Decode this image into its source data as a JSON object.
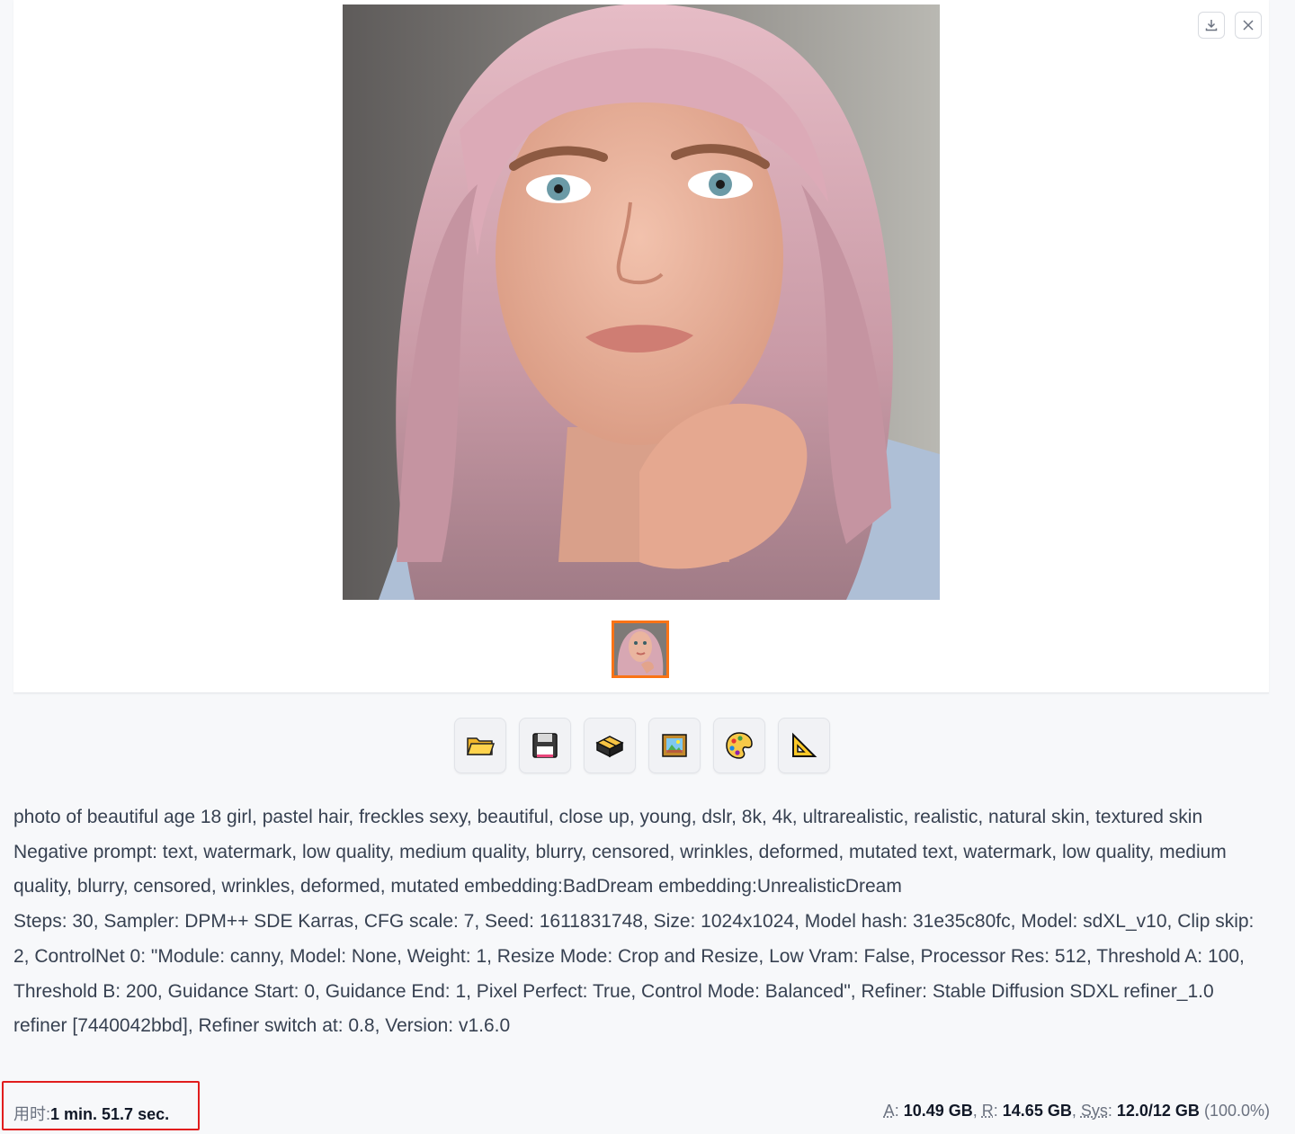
{
  "gallery": {
    "download_icon": "download-icon",
    "close_icon": "close-icon"
  },
  "toolbar": {
    "buttons": [
      {
        "name": "open-folder",
        "icon": "folder-icon"
      },
      {
        "name": "save",
        "icon": "floppy-disk-icon"
      },
      {
        "name": "zip",
        "icon": "package-icon"
      },
      {
        "name": "send-to-img2img",
        "icon": "framed-picture-icon"
      },
      {
        "name": "send-to-inpaint",
        "icon": "palette-icon"
      },
      {
        "name": "send-to-extras",
        "icon": "triangular-ruler-icon"
      }
    ]
  },
  "generation_info": {
    "prompt": "photo of beautiful age 18 girl, pastel hair, freckles sexy, beautiful, close up, young, dslr, 8k, 4k, ultrarealistic, realistic, natural skin, textured skin",
    "negative_prompt": "Negative prompt: text, watermark, low quality, medium quality, blurry, censored, wrinkles, deformed, mutated text, watermark, low quality, medium quality, blurry, censored, wrinkles, deformed, mutated embedding:BadDream embedding:UnrealisticDream",
    "parameters": "Steps: 30, Sampler: DPM++ SDE Karras, CFG scale: 7, Seed: 1611831748, Size: 1024x1024, Model hash: 31e35c80fc, Model: sdXL_v10, Clip skip: 2, ControlNet 0: \"Module: canny, Model: None, Weight: 1, Resize Mode: Crop and Resize, Low Vram: False, Processor Res: 512, Threshold A: 100, Threshold B: 200, Guidance Start: 0, Guidance End: 1, Pixel Perfect: True, Control Mode: Balanced\", Refiner: Stable Diffusion SDXL refiner_1.0 refiner [7440042bbd], Refiner switch at: 0.8, Version: v1.6.0"
  },
  "footer": {
    "time_label": "用时:",
    "time_value": "1 min. 51.7 sec.",
    "mem_a_label": "A",
    "mem_a_value": "10.49 GB",
    "mem_r_label": "R",
    "mem_r_value": "14.65 GB",
    "mem_sys_label": "Sys",
    "mem_sys_value": "12.0/12 GB",
    "mem_sys_pct": "(100.0%)"
  },
  "colors": {
    "selected_border": "#f97316",
    "highlight": "#e11d1d"
  }
}
